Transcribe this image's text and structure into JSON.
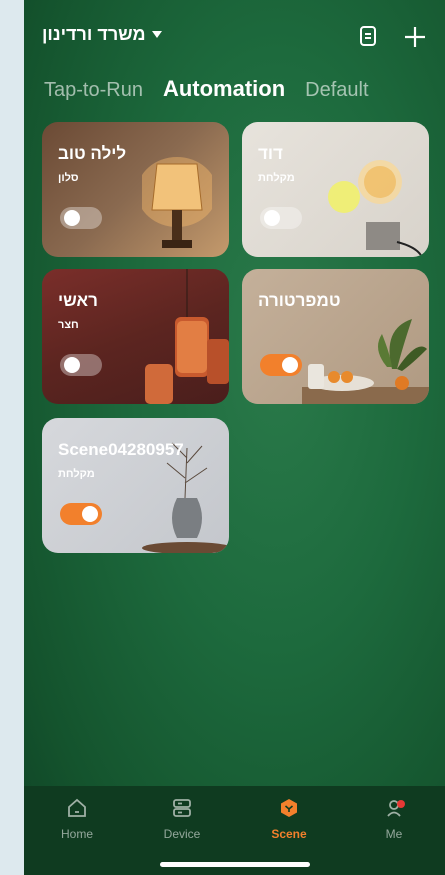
{
  "header": {
    "home_name": "משרד ורדינון",
    "icons": [
      "document-icon",
      "plus-icon"
    ]
  },
  "tabs": [
    {
      "label": "Tap-to-Run",
      "active": false
    },
    {
      "label": "Automation",
      "active": true
    },
    {
      "label": "Default",
      "active": false
    }
  ],
  "scenes": [
    {
      "title": "לילה טוב",
      "room": "סלון",
      "enabled": false
    },
    {
      "title": "דוד",
      "room": "מקלחת",
      "enabled": false
    },
    {
      "title": "ראשי",
      "room": "חצר",
      "enabled": false
    },
    {
      "title": "טמפרטורה",
      "room": "",
      "enabled": true
    },
    {
      "title": "Scene04280957",
      "room": "מקלחת",
      "enabled": true
    }
  ],
  "nav": [
    {
      "label": "Home",
      "icon": "home-icon",
      "active": false
    },
    {
      "label": "Device",
      "icon": "device-icon",
      "active": false
    },
    {
      "label": "Scene",
      "icon": "scene-icon",
      "active": true
    },
    {
      "label": "Me",
      "icon": "profile-icon",
      "active": false
    }
  ],
  "colors": {
    "accent": "#f2802c",
    "background": "#1d6a3d"
  }
}
